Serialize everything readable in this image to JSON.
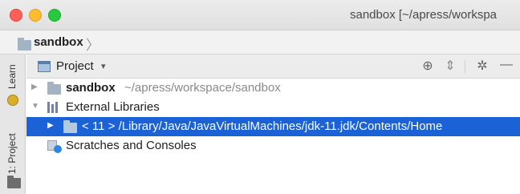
{
  "window": {
    "title": "sandbox [~/apress/workspa"
  },
  "navbar": {
    "project_label": "sandbox",
    "chevron": "〉"
  },
  "side_strip": {
    "learn_tab": "Learn",
    "project_tab": "1: Project"
  },
  "tool_window": {
    "view_label": "Project",
    "view_caret": "▾",
    "buttons": {
      "globe": "⊕",
      "collapse": "⇕",
      "gear": "✲",
      "minimize": "—"
    }
  },
  "tree": {
    "items": [
      {
        "name": "sandbox",
        "path": "~/apress/workspace/sandbox",
        "arrow": "▶"
      },
      {
        "name": "External Libraries",
        "arrow": "▼"
      },
      {
        "name": "< 11 > /Library/Java/JavaVirtualMachines/jdk-11.jdk/Contents/Home",
        "arrow": "▶"
      },
      {
        "name": "Scratches and Consoles"
      }
    ]
  },
  "colors": {
    "selection": "#1a62d6",
    "traffic_red": "#fe5f57",
    "traffic_yellow": "#febc2e",
    "traffic_green": "#28c840"
  }
}
